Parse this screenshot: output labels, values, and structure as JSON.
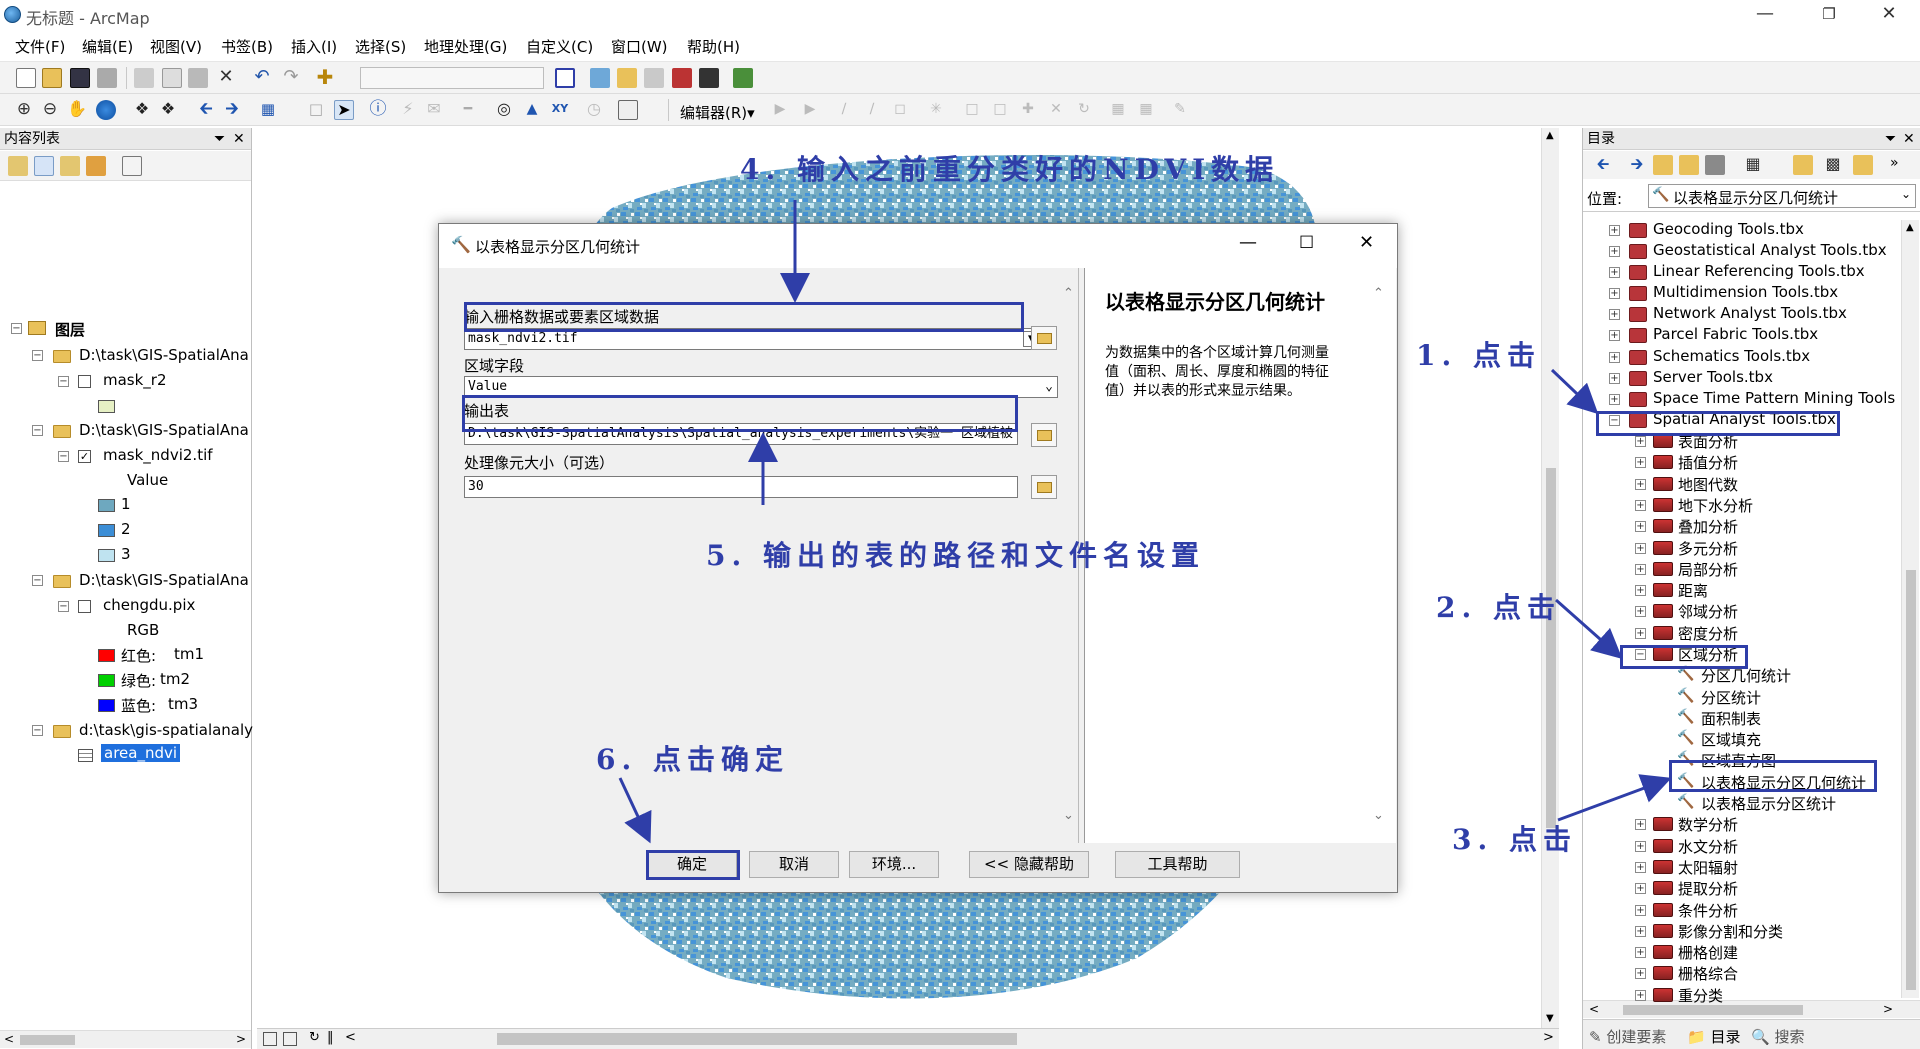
{
  "app": {
    "title": "无标题 - ArcMap"
  },
  "menu": [
    "文件(F)",
    "编辑(E)",
    "视图(V)",
    "书签(B)",
    "插入(I)",
    "选择(S)",
    "地理处理(G)",
    "自定义(C)",
    "窗口(W)",
    "帮助(H)"
  ],
  "toolbar": {
    "editor_label": "编辑器(R)▾"
  },
  "toc": {
    "title": "内容列表",
    "layers_root": "图层",
    "items": [
      "D:\\task\\GIS-SpatialAna",
      "mask_r2",
      "D:\\task\\GIS-SpatialAna",
      "mask_ndvi2.tif",
      "Value",
      "1",
      "2",
      "3",
      "D:\\task\\GIS-SpatialAna",
      "chengdu.pix",
      "RGB",
      "红色:",
      "tm1",
      "绿色:",
      "tm2",
      "蓝色:",
      "tm3",
      "d:\\task\\gis-spatialanaly",
      "area_ndvi"
    ]
  },
  "colors": {
    "accent": "#2f3ea8",
    "sw_r2": "#e6f0c4",
    "sw1": "#6ea8bf",
    "sw2": "#3c8ed6",
    "sw3": "#bfe3f0",
    "red": "#ff0000",
    "green": "#00d000",
    "blue": "#0000ff"
  },
  "dialog": {
    "title": "以表格显示分区几何统计",
    "input_label": "输入栅格数据或要素区域数据",
    "input_value": "mask_ndvi2.tif",
    "zone_label": "区域字段",
    "zone_value": "Value",
    "out_label": "输出表",
    "out_value": "D:\\task\\GIS-SpatialAnalysis\\Spatial_analysis_experiments\\实验一 区域植被",
    "cell_label": "处理像元大小（可选）",
    "cell_value": "30",
    "help_title": "以表格显示分区几何统计",
    "help_text": "为数据集中的各个区域计算几何测量值（面积、周长、厚度和椭圆的特征值）并以表的形式来显示结果。",
    "buttons": [
      "确定",
      "取消",
      "环境...",
      "<< 隐藏帮助",
      "工具帮助"
    ]
  },
  "catalog": {
    "title": "目录",
    "location_label": "位置:",
    "location_value": "以表格显示分区几何统计",
    "toolboxes": [
      "Geocoding Tools.tbx",
      "Geostatistical Analyst Tools.tbx",
      "Linear Referencing Tools.tbx",
      "Multidimension Tools.tbx",
      "Network Analyst Tools.tbx",
      "Parcel Fabric Tools.tbx",
      "Schematics Tools.tbx",
      "Server Tools.tbx",
      "Space Time Pattern Mining Tools",
      "Spatial Analyst Tools.tbx"
    ],
    "sets_a": [
      "表面分析",
      "插值分析",
      "地图代数",
      "地下水分析",
      "叠加分析",
      "多元分析",
      "局部分析",
      "距离",
      "邻域分析",
      "密度分析",
      "区域分析"
    ],
    "zonal_tools": [
      "分区几何统计",
      "分区统计",
      "面积制表",
      "区域填充",
      "区域直方图",
      "以表格显示分区几何统计",
      "以表格显示分区统计"
    ],
    "sets_b": [
      "数学分析",
      "水文分析",
      "太阳辐射",
      "提取分析",
      "条件分析",
      "影像分割和分类",
      "栅格创建",
      "栅格综合",
      "重分类"
    ],
    "bottom_tabs": [
      "创建要素",
      "目录",
      "搜索"
    ]
  },
  "annotations": {
    "a1": "1. 点击",
    "a2": "2. 点击",
    "a3": "3. 点击",
    "a4": "4. 输入之前重分类好的NDVI数据",
    "a5": "5. 输出的表的路径和文件名设置",
    "a6": "6. 点击确定"
  }
}
